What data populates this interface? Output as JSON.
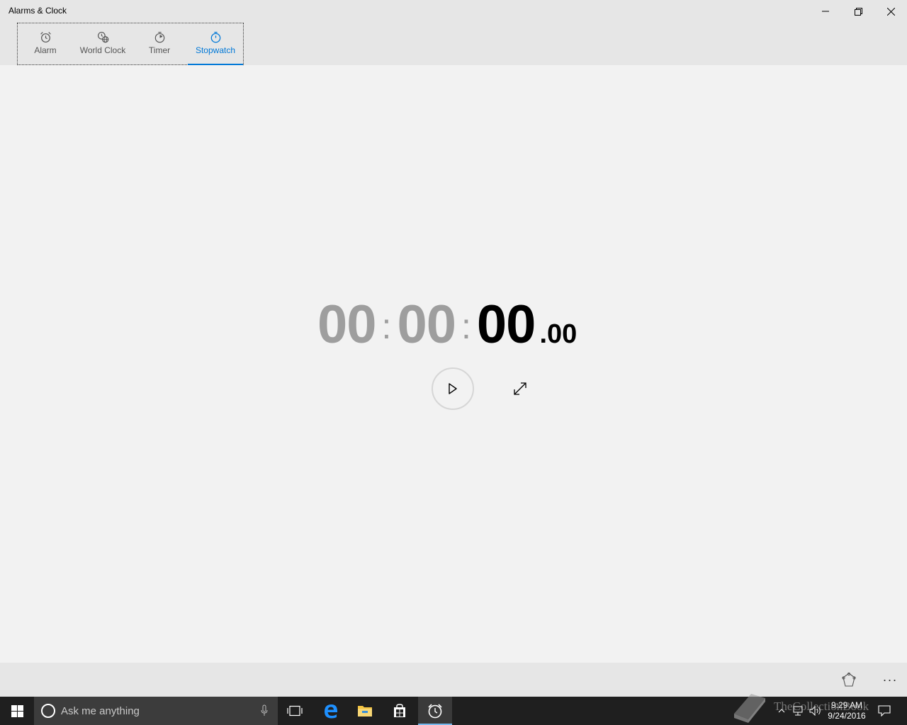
{
  "window": {
    "title": "Alarms & Clock"
  },
  "tabs": [
    {
      "label": "Alarm",
      "icon": "alarm-clock-icon"
    },
    {
      "label": "World Clock",
      "icon": "world-clock-icon"
    },
    {
      "label": "Timer",
      "icon": "timer-icon"
    },
    {
      "label": "Stopwatch",
      "icon": "stopwatch-icon",
      "selected": true
    }
  ],
  "stopwatch": {
    "hours": "00",
    "minutes": "00",
    "seconds": "00",
    "fraction": ".00",
    "separator": ":"
  },
  "controls": {
    "play_icon": "play-icon",
    "expand_icon": "expand-icon"
  },
  "commandbar": {
    "pin_icon": "pin-to-start-icon",
    "more_label": "···"
  },
  "taskbar": {
    "search_placeholder": "Ask me anything",
    "time": "9:29 AM",
    "date": "9/24/2016"
  },
  "watermark": {
    "text": "TheCollectionBook"
  },
  "colors": {
    "accent": "#0078d7",
    "chrome": "#e6e6e6",
    "background": "#f2f2f2",
    "taskbar": "#1f1f1f",
    "dim_digits": "#9e9e9e"
  }
}
